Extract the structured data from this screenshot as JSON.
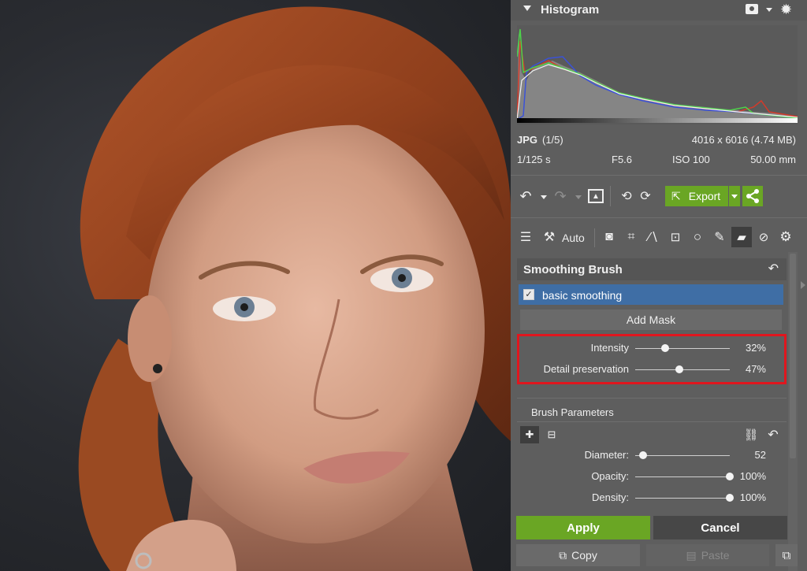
{
  "histogram": {
    "title": "Histogram",
    "format": "JPG",
    "index": "(1/5)",
    "dimensions": "4016 x 6016 (4.74 MB)",
    "shutter": "1/125 s",
    "aperture": "F5.6",
    "iso": "ISO 100",
    "focal": "50.00 mm"
  },
  "toolbar": {
    "export_label": "Export",
    "auto_label": "Auto"
  },
  "tool": {
    "title": "Smoothing Brush",
    "mask_name": "basic smoothing",
    "add_mask_label": "Add Mask",
    "sliders": [
      {
        "label": "Intensity",
        "value_text": "32%",
        "value": 0.32
      },
      {
        "label": "Detail preservation",
        "value_text": "47%",
        "value": 0.47
      }
    ]
  },
  "brush": {
    "title": "Brush Parameters",
    "sliders": [
      {
        "label": "Diameter:",
        "value_text": "52",
        "value": 0.08
      },
      {
        "label": "Opacity:",
        "value_text": "100%",
        "value": 1.0
      },
      {
        "label": "Density:",
        "value_text": "100%",
        "value": 1.0
      }
    ]
  },
  "actions": {
    "apply_label": "Apply",
    "cancel_label": "Cancel",
    "copy_label": "Copy",
    "paste_label": "Paste"
  },
  "colors": {
    "panel": "#5e5e5e",
    "accent_green": "#6aa624",
    "highlight_blue": "#3f6ea5",
    "annotation_red": "#e0161e"
  }
}
